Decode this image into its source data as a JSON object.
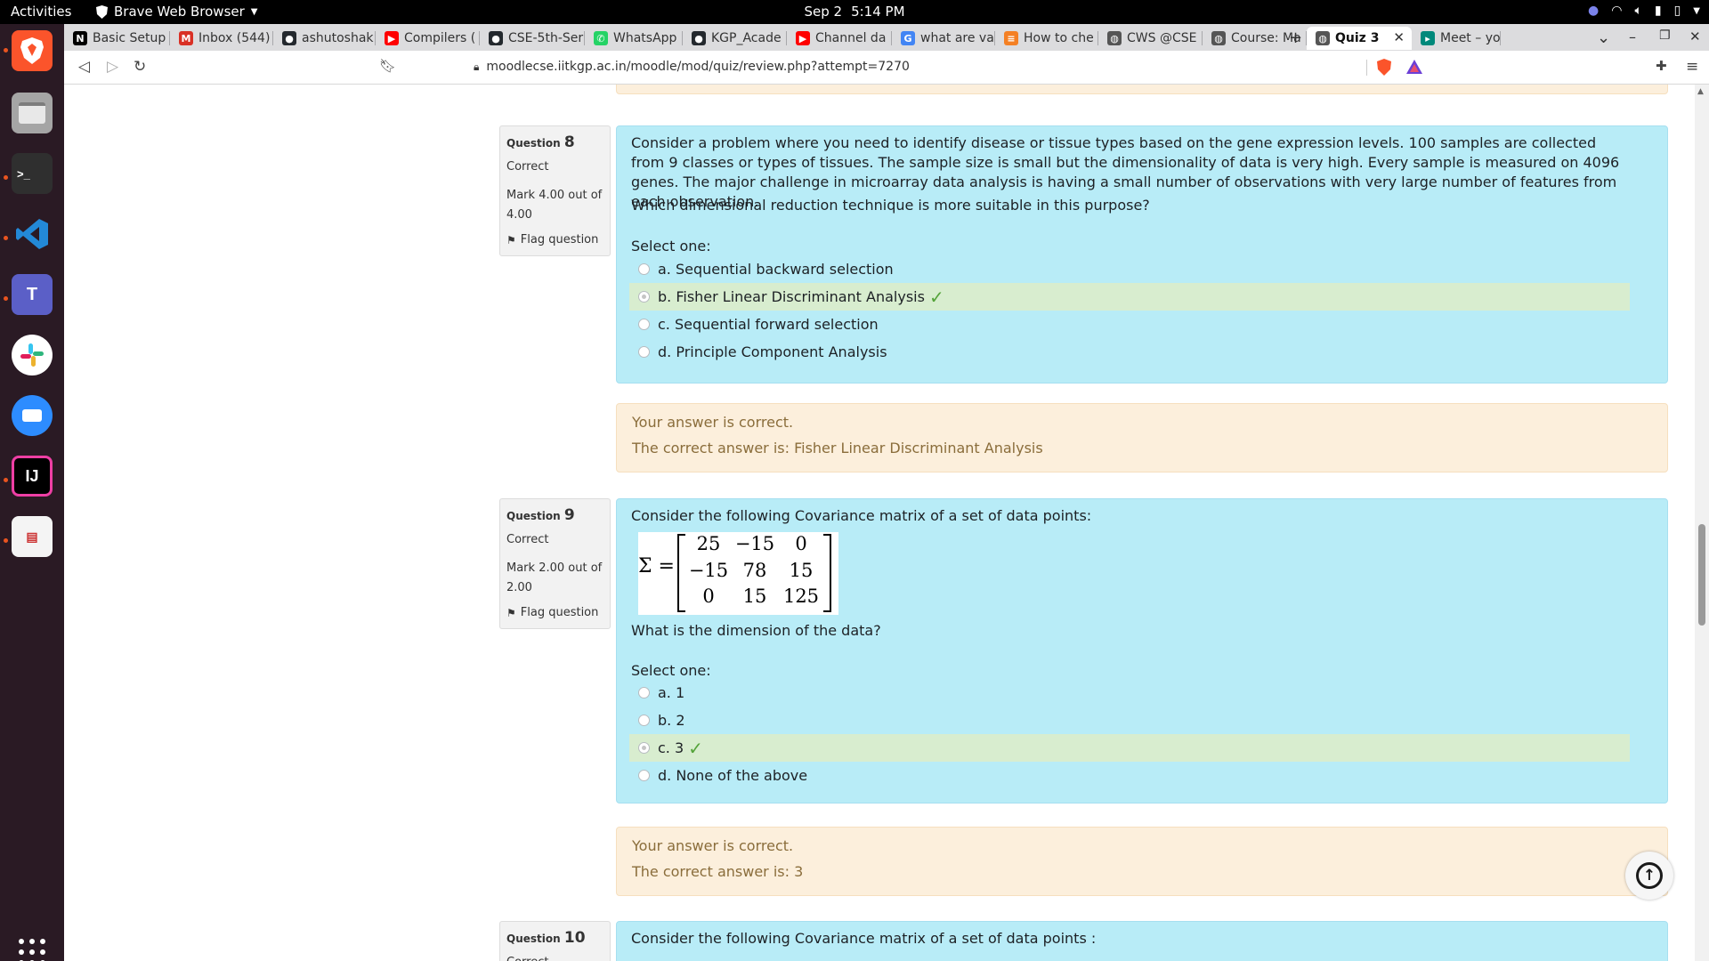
{
  "topbar": {
    "activities": "Activities",
    "app_name": "Brave Web Browser",
    "date": "Sep 2",
    "time": "5:14 PM"
  },
  "dock": {
    "items": [
      "brave-browser",
      "files",
      "terminal",
      "vscode",
      "teams",
      "slack",
      "zoom",
      "intellij",
      "document-viewer"
    ]
  },
  "tabs": [
    {
      "label": "Basic Setup",
      "icon": "notion-icon",
      "color": "#000000"
    },
    {
      "label": "Inbox (544)",
      "icon": "gmail-icon",
      "color": "#d93025"
    },
    {
      "label": "ashutoshak",
      "icon": "github-icon",
      "color": "#24292e"
    },
    {
      "label": "Compilers (",
      "icon": "youtube-icon",
      "color": "#ff0000"
    },
    {
      "label": "CSE-5th-Ser",
      "icon": "github-icon",
      "color": "#24292e"
    },
    {
      "label": "WhatsApp",
      "icon": "whatsapp-icon",
      "color": "#25d366"
    },
    {
      "label": "KGP_Acade",
      "icon": "github-icon",
      "color": "#24292e"
    },
    {
      "label": "Channel da",
      "icon": "youtube-icon",
      "color": "#ff0000"
    },
    {
      "label": "what are va",
      "icon": "google-icon",
      "color": "#4285f4"
    },
    {
      "label": "How to che",
      "icon": "stackoverflow-icon",
      "color": "#f48024"
    },
    {
      "label": "CWS @CSE",
      "icon": "moodle-icon",
      "color": "#555555"
    },
    {
      "label": "Course: Ma",
      "icon": "moodle-icon",
      "color": "#555555"
    },
    {
      "label": "Quiz 3",
      "icon": "moodle-icon",
      "color": "#555555",
      "active": true
    },
    {
      "label": "Meet – yo",
      "icon": "meet-icon",
      "color": "#00897b"
    }
  ],
  "address": {
    "url": "moodlecse.iitkgp.ac.in/moodle/mod/quiz/review.php?attempt=7270"
  },
  "questions": [
    {
      "label": "Question",
      "number": "8",
      "state": "Correct",
      "grade": "Mark 4.00 out of 4.00",
      "flag": "Flag question",
      "paragraph1": "Consider a problem where you need to identify disease or tissue types based on the gene expression levels. 100 samples are collected from 9 classes or types of tissues. The sample size is small but the dimensionality of data is very high. Every sample is measured on 4096 genes. The major challenge in microarray data analysis is having a small number of observations with very large number of features from each observation.",
      "paragraph2": "Which dimensional reduction technique is more suitable in this purpose?",
      "prompt": "Select one:",
      "options": [
        {
          "text": "a. Sequential backward selection",
          "selected": false
        },
        {
          "text": "b. Fisher Linear Discriminant Analysis",
          "selected": true
        },
        {
          "text": "c. Sequential forward selection",
          "selected": false
        },
        {
          "text": "d. Principle Component Analysis",
          "selected": false
        }
      ],
      "feedback": "Your answer is correct.",
      "right_answer": "The correct answer is: Fisher Linear Discriminant Analysis"
    },
    {
      "label": "Question",
      "number": "9",
      "state": "Correct",
      "grade": "Mark 2.00 out of 2.00",
      "flag": "Flag question",
      "paragraph1": "Consider the following Covariance matrix of a set of data points:",
      "matrix": {
        "symbol": "Σ =",
        "rows": [
          [
            "25",
            "−15",
            "0"
          ],
          [
            "−15",
            "78",
            "15"
          ],
          [
            "0",
            "15",
            "125"
          ]
        ]
      },
      "paragraph2": "What is the dimension of the data?",
      "prompt": "Select one:",
      "options": [
        {
          "text": "a. 1",
          "selected": false
        },
        {
          "text": "b. 2",
          "selected": false
        },
        {
          "text": "c. 3",
          "selected": true
        },
        {
          "text": "d. None of the above",
          "selected": false
        }
      ],
      "feedback": "Your answer is correct.",
      "right_answer": "The correct answer is: 3"
    },
    {
      "label": "Question",
      "number": "10",
      "state": "Correct",
      "paragraph1": "Consider the following Covariance matrix of a set of data points :"
    }
  ],
  "colors": {
    "question_bg": "#b8ecf7",
    "feedback_bg": "#fcefdc",
    "correct_option_bg": "#d8edcf",
    "check": "#54a33a"
  }
}
